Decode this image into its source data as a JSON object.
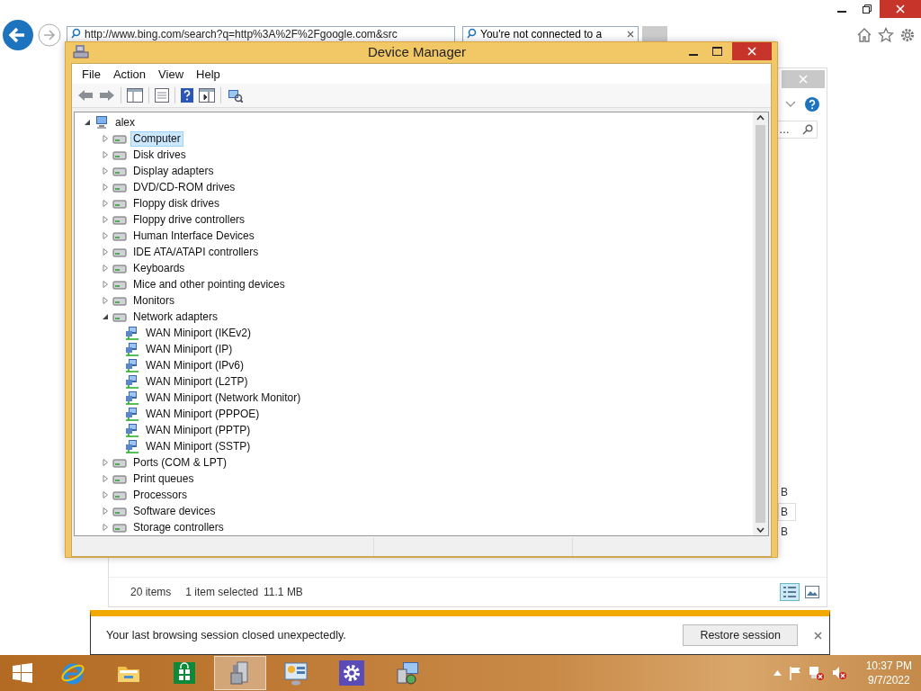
{
  "browser": {
    "address": "http://www.bing.com/search?q=http%3A%2F%2Fgoogle.com&src",
    "tab": {
      "title": "You're not connected to a",
      "selected": true
    }
  },
  "background_window": {
    "search_placeholder": "…",
    "rows": [
      {
        "size": "B",
        "selected": false
      },
      {
        "size": "B",
        "selected": true
      },
      {
        "size": "B",
        "selected": false
      }
    ],
    "status": {
      "items": "20 items",
      "selection": "1 item selected",
      "size": "11.1 MB"
    }
  },
  "device_manager": {
    "title": "Device Manager",
    "menu": [
      "File",
      "Action",
      "View",
      "Help"
    ],
    "tree": {
      "label": "alex",
      "expanded": true,
      "children": [
        {
          "label": "Computer",
          "expanded": false,
          "selected": true
        },
        {
          "label": "Disk drives",
          "expanded": false,
          "selected": false
        },
        {
          "label": "Display adapters",
          "expanded": false,
          "selected": false
        },
        {
          "label": "DVD/CD-ROM drives",
          "expanded": false,
          "selected": false
        },
        {
          "label": "Floppy disk drives",
          "expanded": false,
          "selected": false
        },
        {
          "label": "Floppy drive controllers",
          "expanded": false,
          "selected": false
        },
        {
          "label": "Human Interface Devices",
          "expanded": false,
          "selected": false
        },
        {
          "label": "IDE ATA/ATAPI controllers",
          "expanded": false,
          "selected": false
        },
        {
          "label": "Keyboards",
          "expanded": false,
          "selected": false
        },
        {
          "label": "Mice and other pointing devices",
          "expanded": false,
          "selected": false
        },
        {
          "label": "Monitors",
          "expanded": false,
          "selected": false
        },
        {
          "label": "Network adapters",
          "expanded": true,
          "selected": false,
          "children": [
            {
              "label": "WAN Miniport (IKEv2)",
              "selected": false
            },
            {
              "label": "WAN Miniport (IP)",
              "selected": false
            },
            {
              "label": "WAN Miniport (IPv6)",
              "selected": false
            },
            {
              "label": "WAN Miniport (L2TP)",
              "selected": false
            },
            {
              "label": "WAN Miniport (Network Monitor)",
              "selected": false
            },
            {
              "label": "WAN Miniport (PPPOE)",
              "selected": false
            },
            {
              "label": "WAN Miniport (PPTP)",
              "selected": false
            },
            {
              "label": "WAN Miniport (SSTP)",
              "selected": false
            }
          ]
        },
        {
          "label": "Ports (COM & LPT)",
          "expanded": false,
          "selected": false
        },
        {
          "label": "Print queues",
          "expanded": false,
          "selected": false
        },
        {
          "label": "Processors",
          "expanded": false,
          "selected": false
        },
        {
          "label": "Software devices",
          "expanded": false,
          "selected": false
        },
        {
          "label": "Storage controllers",
          "expanded": false,
          "selected": false
        }
      ]
    }
  },
  "notification": {
    "message": "Your last browsing session closed unexpectedly.",
    "button": "Restore session"
  },
  "taskbar": {
    "apps": [
      {
        "kind": "ie",
        "selected": false
      },
      {
        "kind": "explorer",
        "selected": false
      },
      {
        "kind": "store",
        "selected": false
      },
      {
        "kind": "devices",
        "selected": true
      },
      {
        "kind": "panel",
        "selected": false
      },
      {
        "kind": "settings",
        "selected": false
      },
      {
        "kind": "remote",
        "selected": false
      }
    ],
    "clock": {
      "time": "10:37 PM",
      "date": "9/7/2022"
    }
  }
}
